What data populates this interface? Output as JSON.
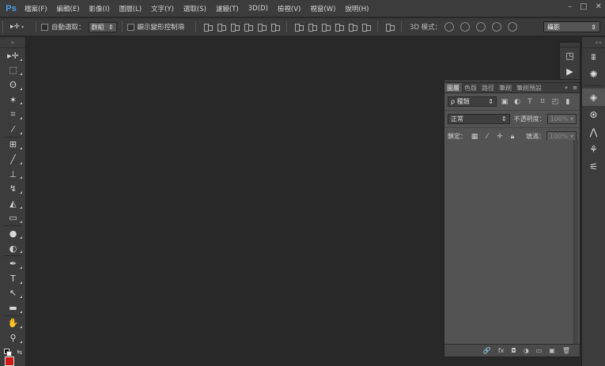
{
  "app": {
    "logo": "Ps",
    "menu": [
      "檔案(F)",
      "編輯(E)",
      "影像(I)",
      "圖層(L)",
      "文字(Y)",
      "選取(S)",
      "濾鏡(T)",
      "3D(D)",
      "檢視(V)",
      "視窗(W)",
      "說明(H)"
    ],
    "window_controls": [
      "–",
      "□",
      "✕"
    ]
  },
  "options_bar": {
    "auto_select_label": "自動選取：",
    "auto_select_value": "群組",
    "show_transform_label": "顯示變形控制項",
    "mode3d_label": "3D 模式：",
    "workspace_value": "攝影"
  },
  "tools": [
    {
      "name": "move-tool",
      "glyph": "▸✛"
    },
    {
      "name": "marquee-tool",
      "glyph": "⬚"
    },
    {
      "name": "lasso-tool",
      "glyph": "ʘ"
    },
    {
      "name": "magic-wand-tool",
      "glyph": "✶"
    },
    {
      "name": "crop-tool",
      "glyph": "⌗"
    },
    {
      "name": "eyedropper-tool",
      "glyph": "⁄"
    },
    {
      "name": "healing-brush-tool",
      "glyph": "⊞"
    },
    {
      "name": "brush-tool",
      "glyph": "╱"
    },
    {
      "name": "clone-stamp-tool",
      "glyph": "⊥"
    },
    {
      "name": "history-brush-tool",
      "glyph": "↯"
    },
    {
      "name": "eraser-tool",
      "glyph": "◭"
    },
    {
      "name": "gradient-tool",
      "glyph": "▭"
    },
    {
      "name": "blur-tool",
      "glyph": "●"
    },
    {
      "name": "dodge-tool",
      "glyph": "◐"
    },
    {
      "name": "pen-tool",
      "glyph": "✒"
    },
    {
      "name": "type-tool",
      "glyph": "T"
    },
    {
      "name": "path-selection-tool",
      "glyph": "↖"
    },
    {
      "name": "shape-tool",
      "glyph": "▬"
    },
    {
      "name": "hand-tool",
      "glyph": "✋"
    },
    {
      "name": "zoom-tool",
      "glyph": "⚲"
    }
  ],
  "colors": {
    "foreground": "#d01818",
    "background": "#ffffff"
  },
  "layers_panel": {
    "tabs": [
      "圖層",
      "色版",
      "路徑",
      "筆刷",
      "筆刷預設"
    ],
    "filter_label": "ρ 種類",
    "blend_mode": "正常",
    "opacity_label": "不透明度：",
    "opacity_value": "100%",
    "lock_label": "鎖定：",
    "fill_label": "填滿：",
    "fill_value": "100%",
    "footer_icons": [
      "🔗",
      "fx",
      "◘",
      "◑",
      "▭",
      "▣",
      "🗑"
    ]
  }
}
